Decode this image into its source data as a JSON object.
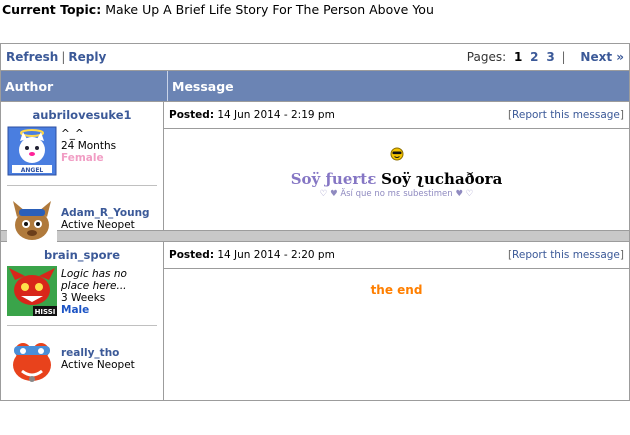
{
  "topic": {
    "label": "Current Topic:",
    "title": "Make Up A Brief Life Story For The Person Above You"
  },
  "nav": {
    "refresh": "Refresh",
    "reply": "Reply",
    "pages_label": "Pages:",
    "current_page": "1",
    "page2": "2",
    "page3": "3",
    "next": "Next »"
  },
  "table": {
    "author_header": "Author",
    "message_header": "Message"
  },
  "posts": [
    {
      "username": "aubrilovesuke1",
      "user_line1": "^_^",
      "user_age": "24 Months",
      "user_gender": "Female",
      "pet_name": "Adam_R_Young",
      "pet_status": "Active Neopet",
      "posted_label": "Posted:",
      "posted_time": "14 Jun 2014 - 2:19 pm",
      "report": "Report this message",
      "message_part1": "Soÿ ƒuertε",
      "message_part2": "Soÿ ʅuchaðora",
      "message_sub": "♡ ♥ Äsí que no mε subestimen ♥ ♡"
    },
    {
      "username": "brain_spore",
      "user_line1": "Logic has no place here...",
      "user_age": "3 Weeks",
      "user_gender": "Male",
      "pet_name": "really_tho",
      "pet_status": "Active Neopet",
      "posted_label": "Posted:",
      "posted_time": "14 Jun 2014 - 2:20 pm",
      "report": "Report this message",
      "message": "the end"
    }
  ],
  "colors": {
    "header": "#6b84b4",
    "link": "#3b5998",
    "female": "#f19dc4",
    "male": "#1c54c5",
    "end": "#ff7f00"
  }
}
